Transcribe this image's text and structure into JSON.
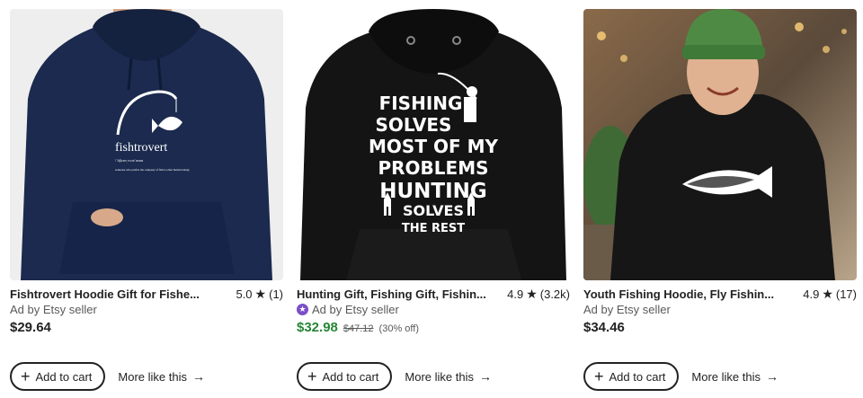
{
  "listings": [
    {
      "title": "Fishtrovert Hoodie Gift for Fishe...",
      "rating": "5.0",
      "review_count": "(1)",
      "seller": "Ad by Etsy seller",
      "star_seller": false,
      "price": "$29.64",
      "original_price": "",
      "discount": "",
      "image_text": {
        "word": "fishtrovert",
        "phonetic": "/ˈfɪʃtrəʊˌvɜːrt/ noun",
        "definition": "someone who prefers the company of fish to other human beings"
      },
      "hoodie_color": "#1b2a4e"
    },
    {
      "title": "Hunting Gift, Fishing Gift, Fishin...",
      "rating": "4.9",
      "review_count": "(3.2k)",
      "seller": "Ad by Etsy seller",
      "star_seller": true,
      "price": "$32.98",
      "original_price": "$47.12",
      "discount": "(30% off)",
      "image_text": {
        "lines": [
          "FISHING",
          "SOLVES",
          "MOST OF MY",
          "PROBLEMS",
          "HUNTING",
          "SOLVES",
          "THE REST"
        ]
      },
      "hoodie_color": "#141414"
    },
    {
      "title": "Youth Fishing Hoodie, Fly Fishin...",
      "rating": "4.9",
      "review_count": "(17)",
      "seller": "Ad by Etsy seller",
      "star_seller": false,
      "price": "$34.46",
      "original_price": "",
      "discount": "",
      "hoodie_color": "#161616"
    }
  ],
  "actions": {
    "add_to_cart": "Add to cart",
    "more_like_this": "More like this"
  },
  "colors": {
    "sale_price": "#258635",
    "star_seller": "#7b4ec9",
    "text": "#222222",
    "muted": "#595959"
  },
  "icons": {
    "rating": "star-icon",
    "add": "plus-icon",
    "more": "arrow-right-icon"
  }
}
